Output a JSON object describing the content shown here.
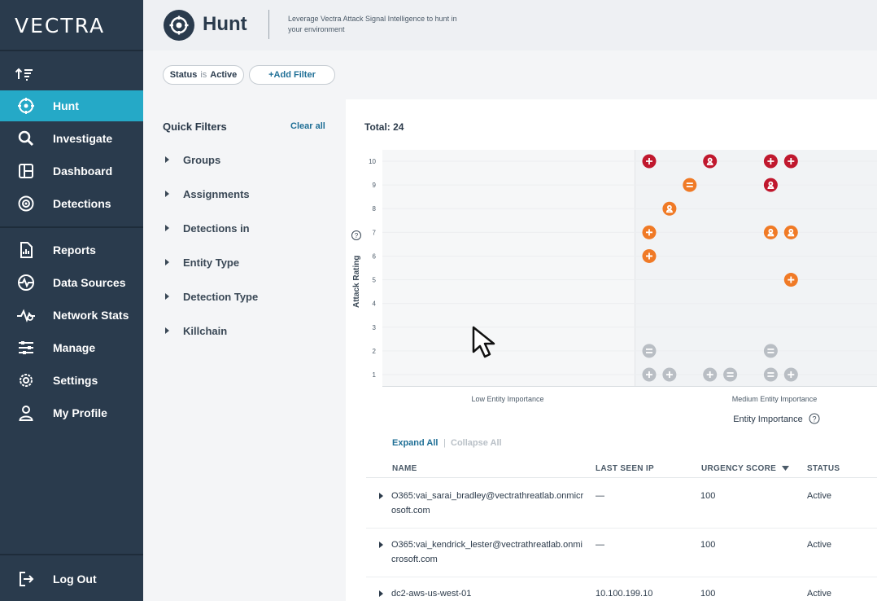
{
  "app": {
    "logo": "VECTRA"
  },
  "sidebar": {
    "items": [
      {
        "label": "Hunt",
        "icon": "crosshair-icon",
        "active": true
      },
      {
        "label": "Investigate",
        "icon": "search-icon",
        "active": false
      },
      {
        "label": "Dashboard",
        "icon": "dashboard-icon",
        "active": false
      },
      {
        "label": "Detections",
        "icon": "at-icon",
        "active": false
      },
      {
        "label": "Reports",
        "icon": "report-icon",
        "active": false
      },
      {
        "label": "Data Sources",
        "icon": "pulse-icon",
        "active": false
      },
      {
        "label": "Network Stats",
        "icon": "network-icon",
        "active": false
      },
      {
        "label": "Manage",
        "icon": "sliders-icon",
        "active": false
      },
      {
        "label": "Settings",
        "icon": "gear-icon",
        "active": false
      },
      {
        "label": "My Profile",
        "icon": "user-icon",
        "active": false
      }
    ],
    "logout": "Log Out"
  },
  "header": {
    "title": "Hunt",
    "description": "Leverage Vectra Attack Signal Intelligence to hunt in your environment"
  },
  "filters": {
    "status_key": "Status",
    "status_op": "is",
    "status_value": "Active",
    "add_filter": "+Add Filter"
  },
  "quick_filters": {
    "title": "Quick Filters",
    "clear_all": "Clear all",
    "items": [
      "Groups",
      "Assignments",
      "Detections in",
      "Entity Type",
      "Detection Type",
      "Killchain"
    ]
  },
  "main": {
    "total": "Total: 24"
  },
  "chart_data": {
    "type": "scatter",
    "ylabel": "Attack Rating",
    "xlabel": "Entity Importance",
    "y_ticks": [
      "10",
      "9",
      "8",
      "7",
      "6",
      "5",
      "4",
      "3",
      "2",
      "1"
    ],
    "x_regions": [
      "Low Entity Importance",
      "Medium Entity Importance"
    ],
    "ylim": [
      1,
      10
    ],
    "colors": {
      "critical": "#c0182e",
      "high": "#f07a26",
      "low": "#b9bec4"
    },
    "points": [
      {
        "slot": 1,
        "y": 10,
        "severity": "critical",
        "icon": "plus"
      },
      {
        "slot": 4,
        "y": 10,
        "severity": "critical",
        "icon": "user"
      },
      {
        "slot": 7,
        "y": 10,
        "severity": "critical",
        "icon": "plus"
      },
      {
        "slot": 8,
        "y": 10,
        "severity": "critical",
        "icon": "plus"
      },
      {
        "slot": 3,
        "y": 9,
        "severity": "high",
        "icon": "minus"
      },
      {
        "slot": 7,
        "y": 9,
        "severity": "critical",
        "icon": "user"
      },
      {
        "slot": 2,
        "y": 8,
        "severity": "high",
        "icon": "user"
      },
      {
        "slot": 1,
        "y": 7,
        "severity": "high",
        "icon": "plus"
      },
      {
        "slot": 7,
        "y": 7,
        "severity": "high",
        "icon": "user"
      },
      {
        "slot": 8,
        "y": 7,
        "severity": "high",
        "icon": "user"
      },
      {
        "slot": 1,
        "y": 6,
        "severity": "high",
        "icon": "plus"
      },
      {
        "slot": 8,
        "y": 5,
        "severity": "high",
        "icon": "plus"
      },
      {
        "slot": 1,
        "y": 2,
        "severity": "low",
        "icon": "minus"
      },
      {
        "slot": 7,
        "y": 2,
        "severity": "low",
        "icon": "minus"
      },
      {
        "slot": 1,
        "y": 1,
        "severity": "low",
        "icon": "plus"
      },
      {
        "slot": 2,
        "y": 1,
        "severity": "low",
        "icon": "plus"
      },
      {
        "slot": 4,
        "y": 1,
        "severity": "low",
        "icon": "plus"
      },
      {
        "slot": 5,
        "y": 1,
        "severity": "low",
        "icon": "minus"
      },
      {
        "slot": 7,
        "y": 1,
        "severity": "low",
        "icon": "minus"
      },
      {
        "slot": 8,
        "y": 1,
        "severity": "low",
        "icon": "plus"
      }
    ]
  },
  "entity_list": {
    "expand_all": "Expand All",
    "separator": "|",
    "collapse_all": "Collapse All",
    "columns": [
      "NAME",
      "LAST SEEN IP",
      "URGENCY SCORE",
      "STATUS"
    ],
    "rows": [
      {
        "name": "O365:vai_sarai_bradley@vectrathreatlab.onmicrosoft.com",
        "ip": "—",
        "score": "100",
        "status": "Active"
      },
      {
        "name": "O365:vai_kendrick_lester@vectrathreatlab.onmicrosoft.com",
        "ip": "—",
        "score": "100",
        "status": "Active"
      },
      {
        "name": "dc2-aws-us-west-01",
        "ip": "10.100.199.10",
        "score": "100",
        "status": "Active"
      }
    ]
  }
}
